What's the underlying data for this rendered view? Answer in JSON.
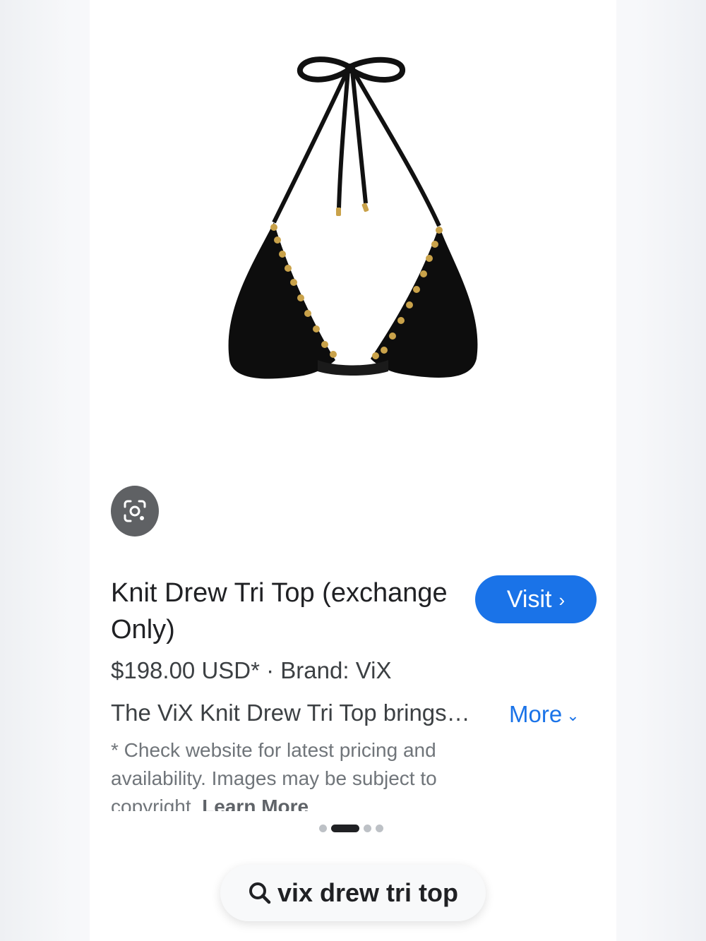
{
  "product": {
    "title": "Knit Drew Tri Top (exchange Only)",
    "price_line": "$198.00 USD* · Brand: ViX",
    "description": "The ViX Knit Drew Tri Top brings…",
    "more_label": "More",
    "disclaimer": "* Check website for latest pricing and availability. Images may be subject to copyright.",
    "learn_more_label": "Learn More"
  },
  "actions": {
    "visit_label": "Visit"
  },
  "carousel": {
    "dot_count": 4,
    "active_index": 1
  },
  "search": {
    "query": "vix drew tri top"
  },
  "icons": {
    "lens": "google-lens-icon",
    "search": "search-icon",
    "visit_chevron": "chevron-right-icon",
    "more_chevron": "chevron-down-icon"
  },
  "colors": {
    "accent": "#1a73e8",
    "lens_button_bg": "#5f6164",
    "text_primary": "#202124",
    "text_secondary": "#3c4043",
    "text_muted": "#70757a"
  }
}
